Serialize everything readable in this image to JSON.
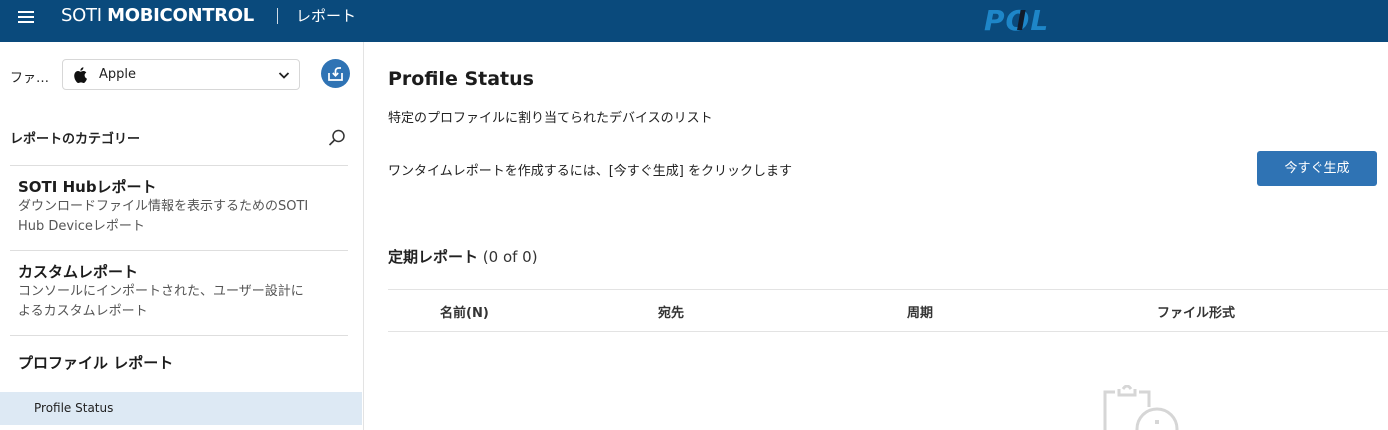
{
  "header": {
    "brand_light": "SOTI ",
    "brand_bold": "MOBICONTROL",
    "section": "レポート",
    "logo_text": "POL",
    "colors": {
      "topbar": "#0a4a7c"
    }
  },
  "sidebar": {
    "filter_label": "ファ…",
    "platform_select": {
      "icon": "apple-icon",
      "value": "Apple"
    },
    "export_icon": "export-icon",
    "categories_header": "レポートのカテゴリー",
    "categories": [
      {
        "title": "SOTI Hubレポート",
        "desc_line1": "ダウンロードファイル情報を表示するためのSOTI",
        "desc_line2": "Hub Deviceレポート"
      },
      {
        "title": "カスタムレポート",
        "desc_line1": "コンソールにインポートされた、ユーザー設計に",
        "desc_line2": "よるカスタムレポート"
      },
      {
        "title": "プロファイル レポート"
      }
    ],
    "selected_item": "Profile Status"
  },
  "main": {
    "title": "Profile Status",
    "description": "特定のプロファイルに割り当てられたデバイスのリスト",
    "instruction": "ワンタイムレポートを作成するには、[今すぐ生成] をクリックします",
    "generate_button": "今すぐ生成",
    "scheduled_label": "定期レポート",
    "scheduled_count": " (0 of 0)",
    "columns": [
      "名前(N)",
      "宛先",
      "周期",
      "ファイル形式"
    ],
    "accent_color": "#2f73b4"
  }
}
